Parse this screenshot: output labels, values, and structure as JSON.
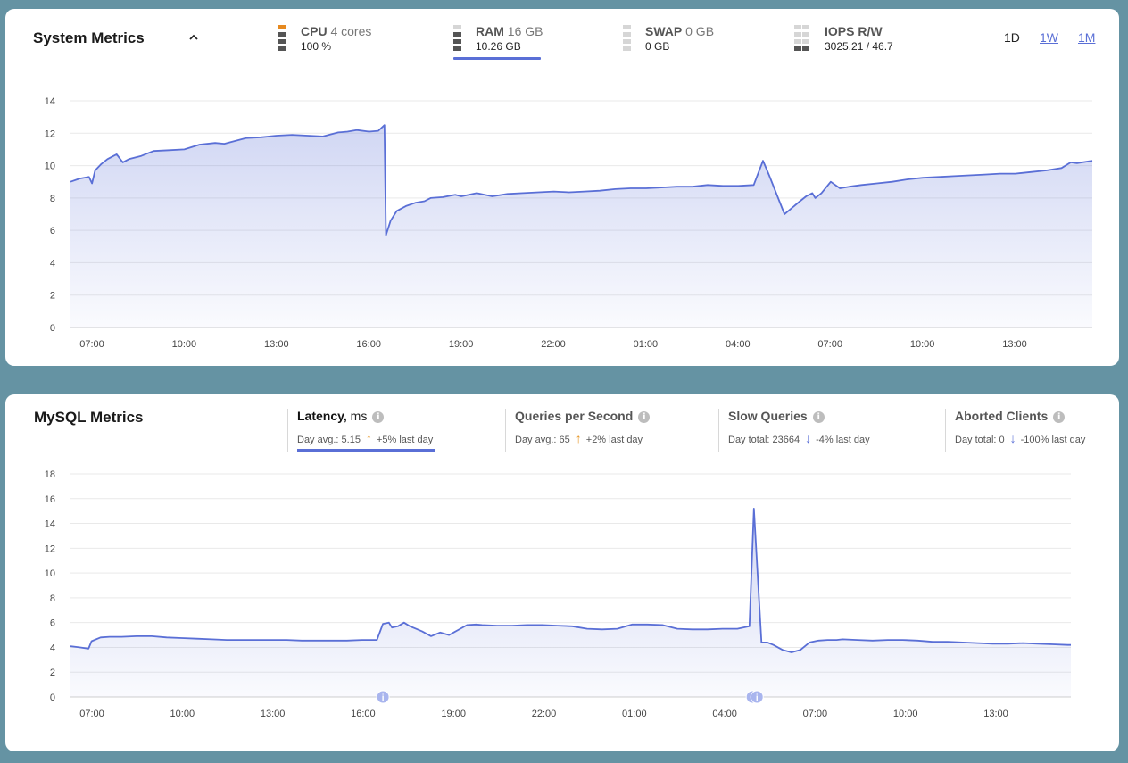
{
  "system": {
    "title": "System Metrics",
    "metrics": [
      {
        "name": "CPU",
        "spec": "4 cores",
        "value": "100 %"
      },
      {
        "name": "RAM",
        "spec": "16 GB",
        "value": "10.26 GB"
      },
      {
        "name": "SWAP",
        "spec": "0 GB",
        "value": "0 GB"
      },
      {
        "name": "IOPS R/W",
        "spec": "",
        "value": "3025.21 / 46.7"
      }
    ],
    "ranges": [
      "1D",
      "1W",
      "1M"
    ],
    "active_range": "1D",
    "active_metric": "RAM"
  },
  "mysql": {
    "title": "MySQL Metrics",
    "tabs": [
      {
        "title": "Latency,",
        "unit": "ms",
        "summary": "Day avg.: 5.15",
        "trend": "up",
        "change": "+5% last day"
      },
      {
        "title": "Queries per Second",
        "unit": "",
        "summary": "Day avg.: 65",
        "trend": "up",
        "change": "+2% last day"
      },
      {
        "title": "Slow Queries",
        "unit": "",
        "summary": "Day total: 23664",
        "trend": "down",
        "change": "-4% last day"
      },
      {
        "title": "Aborted Clients",
        "unit": "",
        "summary": "Day total: 0",
        "trend": "down",
        "change": "-100% last day"
      }
    ],
    "active_tab": "Latency,"
  },
  "colors": {
    "line": "#5a6fd6",
    "accent": "#5a6fd6",
    "cpu_bar": "#e6891f",
    "trend_up": "#e69420",
    "page_bg": "#6593a3"
  },
  "chart_data": [
    {
      "type": "area",
      "x_ticks": [
        "07:00",
        "10:00",
        "13:00",
        "16:00",
        "19:00",
        "22:00",
        "01:00",
        "04:00",
        "07:00",
        "10:00",
        "13:00"
      ],
      "y_ticks": [
        0,
        2,
        4,
        6,
        8,
        10,
        12,
        14
      ],
      "ylim": [
        0,
        14
      ],
      "xlim_hours": [
        6.3,
        39.5
      ],
      "series": [
        {
          "x": [
            6.3,
            6.6,
            6.9,
            7.0,
            7.1,
            7.3,
            7.5,
            7.8,
            8.0,
            8.2,
            8.6,
            9.0,
            9.5,
            10.0,
            10.5,
            11.0,
            11.3,
            11.6,
            12.0,
            12.5,
            13.0,
            13.5,
            14.0,
            14.5,
            15.0,
            15.3,
            15.6,
            16.0,
            16.3,
            16.5,
            16.55,
            16.7,
            16.9,
            17.2,
            17.5,
            17.8,
            18.0,
            18.4,
            18.8,
            19.0,
            19.5,
            20.0,
            20.5,
            21.0,
            21.5,
            22.0,
            22.5,
            23.0,
            23.5,
            24.0,
            24.5,
            25.0,
            25.5,
            26.0,
            26.5,
            27.0,
            27.5,
            28.0,
            28.5,
            28.8,
            29.0,
            29.5,
            30.0,
            30.2,
            30.4,
            30.5,
            30.7,
            31.0,
            31.3,
            31.6,
            32.0,
            32.5,
            33.0,
            33.5,
            34.0,
            34.5,
            35.0,
            35.5,
            36.0,
            36.5,
            37.0,
            37.5,
            38.0,
            38.5,
            38.8,
            39.0,
            39.5
          ],
          "values": [
            9.0,
            9.2,
            9.3,
            8.9,
            9.7,
            10.1,
            10.4,
            10.7,
            10.2,
            10.4,
            10.6,
            10.9,
            10.95,
            11.0,
            11.3,
            11.4,
            11.35,
            11.5,
            11.7,
            11.75,
            11.85,
            11.9,
            11.85,
            11.8,
            12.05,
            12.1,
            12.2,
            12.1,
            12.15,
            12.5,
            5.7,
            6.6,
            7.2,
            7.5,
            7.7,
            7.8,
            8.0,
            8.05,
            8.2,
            8.1,
            8.3,
            8.1,
            8.25,
            8.3,
            8.35,
            8.4,
            8.35,
            8.4,
            8.45,
            8.55,
            8.6,
            8.6,
            8.65,
            8.7,
            8.7,
            8.8,
            8.75,
            8.75,
            8.8,
            10.3,
            9.4,
            7.0,
            7.8,
            8.1,
            8.3,
            8.0,
            8.3,
            9.0,
            8.6,
            8.7,
            8.8,
            8.9,
            9.0,
            9.15,
            9.25,
            9.3,
            9.35,
            9.4,
            9.45,
            9.5,
            9.5,
            9.6,
            9.7,
            9.85,
            10.2,
            10.15,
            10.3
          ]
        }
      ]
    },
    {
      "type": "area",
      "x_ticks": [
        "07:00",
        "10:00",
        "13:00",
        "16:00",
        "19:00",
        "22:00",
        "01:00",
        "04:00",
        "07:00",
        "10:00",
        "13:00"
      ],
      "y_ticks": [
        0,
        2,
        4,
        6,
        8,
        10,
        12,
        14,
        16,
        18
      ],
      "ylim": [
        0,
        18
      ],
      "xlim_hours": [
        6.3,
        39.6
      ],
      "series": [
        {
          "x": [
            6.3,
            6.6,
            6.9,
            7.0,
            7.3,
            7.6,
            8.0,
            8.5,
            9.0,
            9.5,
            10.0,
            10.5,
            11.0,
            11.5,
            12.0,
            12.5,
            13.0,
            13.5,
            14.0,
            14.5,
            15.0,
            15.5,
            16.0,
            16.5,
            16.7,
            16.9,
            17.0,
            17.2,
            17.4,
            17.6,
            17.8,
            18.0,
            18.3,
            18.6,
            18.9,
            19.2,
            19.5,
            19.8,
            20.0,
            20.5,
            21.0,
            21.5,
            22.0,
            22.5,
            23.0,
            23.5,
            24.0,
            24.5,
            25.0,
            25.5,
            26.0,
            26.5,
            27.0,
            27.5,
            28.0,
            28.5,
            28.9,
            29.05,
            29.3,
            29.5,
            29.7,
            30.0,
            30.3,
            30.6,
            30.9,
            31.2,
            31.5,
            31.8,
            32.0,
            32.5,
            33.0,
            33.5,
            34.0,
            34.5,
            35.0,
            35.5,
            36.0,
            36.5,
            37.0,
            37.5,
            38.0,
            38.5,
            39.0,
            39.5,
            39.6
          ],
          "values": [
            4.1,
            4.0,
            3.9,
            4.5,
            4.8,
            4.85,
            4.85,
            4.9,
            4.9,
            4.8,
            4.75,
            4.7,
            4.65,
            4.6,
            4.6,
            4.6,
            4.6,
            4.6,
            4.55,
            4.55,
            4.55,
            4.55,
            4.6,
            4.6,
            5.9,
            6.0,
            5.6,
            5.7,
            6.0,
            5.7,
            5.5,
            5.3,
            4.9,
            5.2,
            5.0,
            5.4,
            5.8,
            5.85,
            5.8,
            5.75,
            5.75,
            5.8,
            5.8,
            5.75,
            5.7,
            5.5,
            5.45,
            5.5,
            5.85,
            5.85,
            5.8,
            5.5,
            5.45,
            5.45,
            5.5,
            5.5,
            5.7,
            15.2,
            4.4,
            4.4,
            4.2,
            3.8,
            3.6,
            3.8,
            4.4,
            4.55,
            4.6,
            4.6,
            4.65,
            4.6,
            4.55,
            4.6,
            4.6,
            4.55,
            4.45,
            4.45,
            4.4,
            4.35,
            4.3,
            4.3,
            4.35,
            4.3,
            4.25,
            4.2,
            4.2
          ]
        }
      ],
      "markers_hours": [
        16.7,
        29.0,
        29.15
      ]
    }
  ]
}
